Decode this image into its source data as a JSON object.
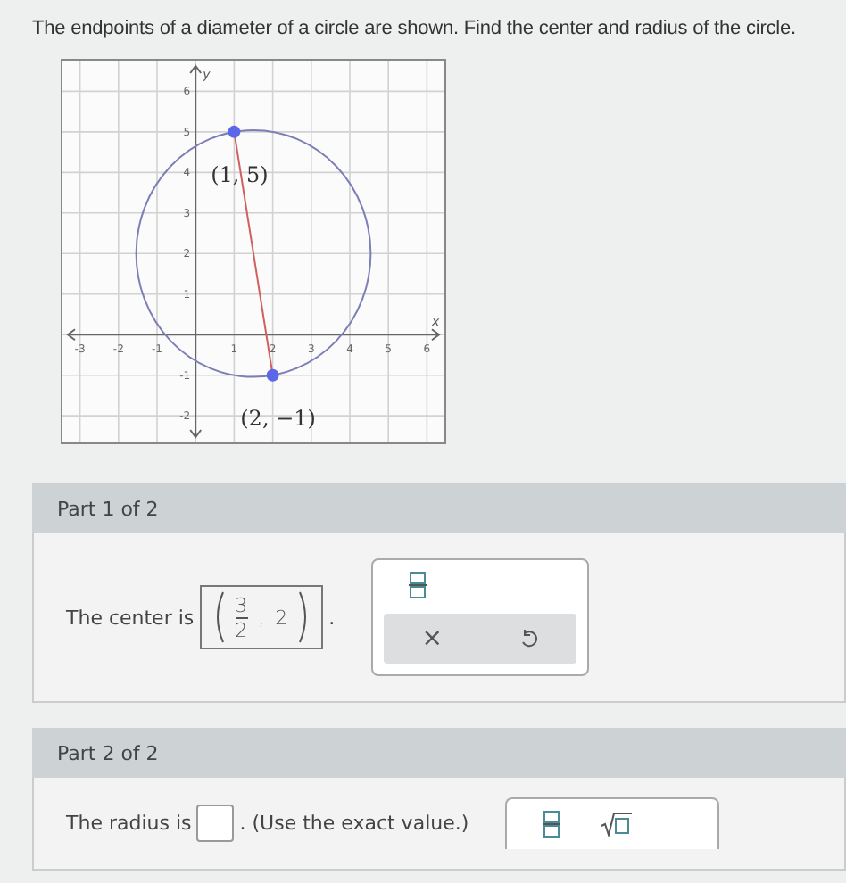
{
  "question": "The endpoints of a diameter of a circle are shown. Find the center and radius of the circle.",
  "graph": {
    "chart_data": {
      "type": "scatter",
      "grid": true,
      "xlabel": "x",
      "ylabel": "y",
      "xlim": [
        -3.5,
        6.5
      ],
      "ylim": [
        -2.7,
        6.8
      ],
      "xticks": [
        -3,
        -2,
        -1,
        1,
        2,
        3,
        4,
        5,
        6
      ],
      "yticks": [
        -2,
        -1,
        1,
        2,
        3,
        4,
        5,
        6
      ],
      "x": [
        1,
        2
      ],
      "series": [
        {
          "type": "line",
          "color": "#d06060",
          "values": [
            5,
            -1
          ]
        },
        {
          "type": "scatter",
          "color": "#5b67e8",
          "values": [
            5,
            -1
          ]
        }
      ],
      "annotations": [
        {
          "x": 1,
          "y": 5,
          "text": "(1, 5)"
        },
        {
          "x": 2,
          "y": -1,
          "text": "(2, −1)"
        }
      ]
    }
  },
  "parts": [
    {
      "kind": "center",
      "title": "Part 1 of 2",
      "prompt": "The center is",
      "numerator": "3",
      "denominator": "2",
      "separator": ",",
      "second": "2",
      "after": ".",
      "tools": [
        {
          "kind": "fraction"
        }
      ],
      "actions": [
        {
          "kind": "clear",
          "label": "×"
        },
        {
          "kind": "undo"
        }
      ]
    },
    {
      "kind": "radius",
      "title": "Part 2 of 2",
      "prompt": "The radius is",
      "after": ". (Use the exact value.)",
      "tools": [
        {
          "kind": "fraction"
        },
        {
          "kind": "sqrt"
        }
      ]
    }
  ]
}
